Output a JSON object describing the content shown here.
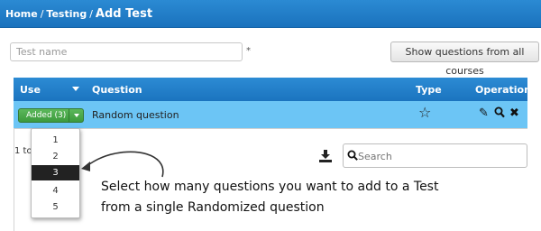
{
  "breadcrumb": {
    "home": "Home",
    "sep1": "/",
    "section": "Testing",
    "sep2": "/",
    "current": "Add Test"
  },
  "form": {
    "test_name_placeholder": "Test name",
    "required_mark": "*",
    "show_questions_label": "Show questions from all courses"
  },
  "table": {
    "columns": {
      "use": "Use",
      "question": "Question",
      "type": "Type",
      "operations": "Operations"
    },
    "row": {
      "added_label": "Added (3)",
      "question": "Random question",
      "type_icon": "star-icon"
    },
    "info_prefix": "1 to"
  },
  "dropdown": {
    "options": [
      "1",
      "2",
      "3",
      "4",
      "5"
    ],
    "selected": "3"
  },
  "search": {
    "placeholder": "Search"
  },
  "annotation": {
    "line1": "Select how many questions you want to add to a Test",
    "line2": "from a single Randomized question"
  },
  "colors": {
    "header_blue": "#1a72bd",
    "row_highlight": "#6cc5f5",
    "added_green": "#4cae4c"
  }
}
